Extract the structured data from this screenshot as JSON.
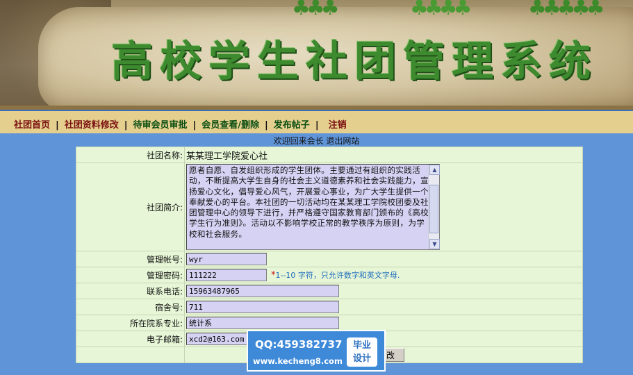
{
  "header": {
    "title": "高校学生社团管理系统"
  },
  "nav": {
    "items": [
      {
        "label": "社团首页",
        "color": "#7a1010"
      },
      {
        "label": "社团资料修改",
        "color": "#7a1010"
      },
      {
        "label": "待审会员审批",
        "color": "#0b4e12"
      },
      {
        "label": "会员查看/删除",
        "color": "#0b4e12"
      },
      {
        "label": "发布帖子",
        "color": "#0b4e12"
      },
      {
        "label": "注销",
        "color": "#7a1010"
      }
    ],
    "separator": "|"
  },
  "welcome": {
    "text": "欢迎回来会长",
    "logout": "退出网站"
  },
  "form": {
    "club_name_label": "社团名称:",
    "club_name_value": "某某理工学院爱心社",
    "intro_label": "社团简介:",
    "intro_value": "愿者自愿、自发组织形成的学生团体。主要通过有组织的实践活动，不断提高大学生自身的社会主义道德素养和社会实践能力，宣扬爱心文化，倡导爱心风气，开展爱心事业，为广大学生提供一个奉献爱心的平台。本社团的一切活动均在某某理工学院校团委及社团管理中心的领导下进行，并严格遵守国家教育部门颁布的《高校学生行为准则》。活动以不影响学校正常的教学秩序为原则，为学校和社会服务。",
    "account_label": "管理帐号:",
    "account_value": "wyr",
    "password_label": "管理密码:",
    "password_value": "111222",
    "password_hint_star": "*",
    "password_hint": "1--10 字符，只允许数字和英文字母.",
    "phone_label": "联系电话:",
    "phone_value": "15963487965",
    "dorm_label": "宿舍号:",
    "dorm_value": "711",
    "major_label": "所在院系专业:",
    "major_value": "统计系",
    "email_label": "电子邮箱:",
    "email_value": "xcd2@163.com",
    "submit_label": "改"
  },
  "watermark": {
    "qq": "QQ:459382737",
    "url": "www.kecheng8.com",
    "badge_line1": "毕业",
    "badge_line2": "设计"
  }
}
